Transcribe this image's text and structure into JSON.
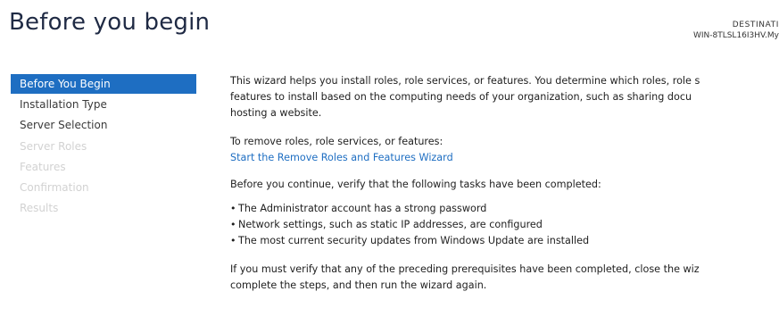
{
  "header": {
    "title": "Before you begin",
    "destination_label": "DESTINATI",
    "destination_server": "WIN-8TLSL16I3HV.My"
  },
  "nav": {
    "items": [
      {
        "label": "Before You Begin",
        "state": "active"
      },
      {
        "label": "Installation Type",
        "state": "enabled"
      },
      {
        "label": "Server Selection",
        "state": "enabled"
      },
      {
        "label": "Server Roles",
        "state": "disabled"
      },
      {
        "label": "Features",
        "state": "disabled"
      },
      {
        "label": "Confirmation",
        "state": "disabled"
      },
      {
        "label": "Results",
        "state": "disabled"
      }
    ]
  },
  "content": {
    "intro_lines": [
      "This wizard helps you install roles, role services, or features. You determine which roles, role s",
      "features to install based on the computing needs of your organization, such as sharing docu",
      "hosting a website."
    ],
    "remove_label": "To remove roles, role services, or features:",
    "remove_link": "Start the Remove Roles and Features Wizard",
    "verify_text": "Before you continue, verify that the following tasks have been completed:",
    "tasks": [
      "The Administrator account has a strong password",
      "Network settings, such as static IP addresses, are configured",
      "The most current security updates from Windows Update are installed"
    ],
    "closing_lines": [
      "If you must verify that any of the preceding prerequisites have been completed, close the wiz",
      "complete the steps, and then run the wizard again."
    ]
  },
  "colors": {
    "accent": "#1e6ec2",
    "title": "#1f2a44",
    "disabled": "#d2d2d2"
  }
}
